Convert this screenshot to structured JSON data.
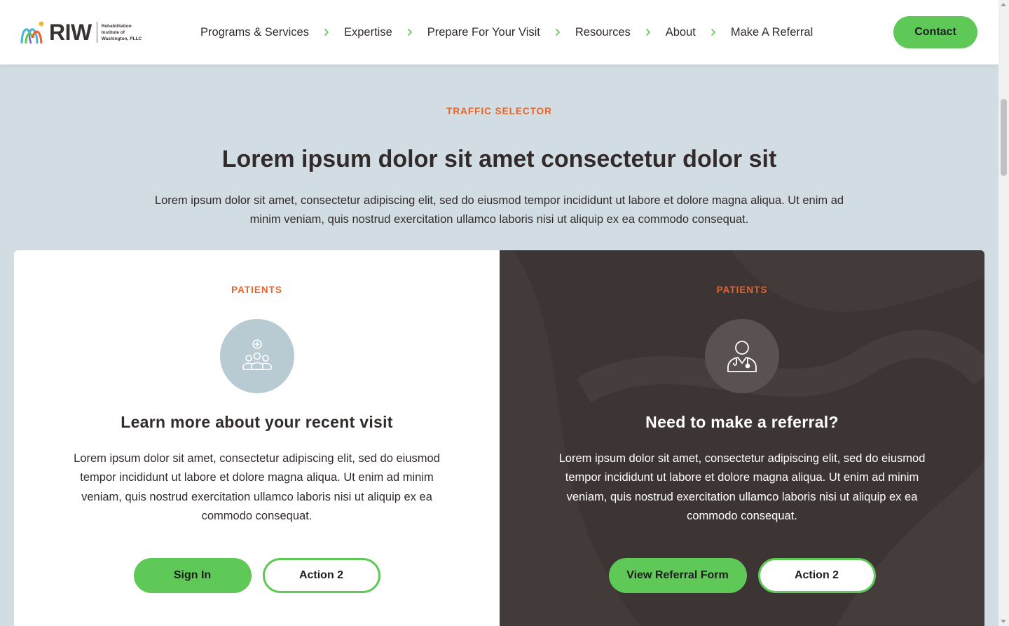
{
  "header": {
    "logo": {
      "wordmark": "RIW",
      "subtitle_lines": [
        "Rehabilitation",
        "Institute of",
        "Washington, PLLC"
      ]
    },
    "nav": [
      {
        "label": "Programs & Services"
      },
      {
        "label": "Expertise"
      },
      {
        "label": "Prepare For Your Visit"
      },
      {
        "label": "Resources"
      },
      {
        "label": "About"
      },
      {
        "label": "Make A Referral"
      }
    ],
    "contact_label": "Contact"
  },
  "intro": {
    "eyebrow": "TRAFFIC SELECTOR",
    "title": "Lorem ipsum dolor sit amet consectetur dolor sit",
    "text": "Lorem ipsum dolor sit amet, consectetur adipiscing elit, sed do eiusmod tempor incididunt ut labore et dolore magna aliqua. Ut enim ad minim veniam, quis nostrud exercitation ullamco laboris nisi ut aliquip ex ea commodo consequat."
  },
  "cards": [
    {
      "eyebrow": "PATIENTS",
      "icon": "patients-group-icon",
      "title": "Learn more about your recent visit",
      "text": "Lorem ipsum dolor sit amet, consectetur adipiscing elit, sed do eiusmod tempor incididunt ut labore et dolore magna aliqua. Ut enim ad minim veniam, quis nostrud exercitation ullamco laboris nisi ut aliquip ex ea commodo consequat.",
      "primary_button": "Sign In",
      "secondary_button": "Action 2"
    },
    {
      "eyebrow": "PATIENTS",
      "icon": "doctor-icon",
      "title": "Need to make a referral?",
      "text": "Lorem ipsum dolor sit amet, consectetur adipiscing elit, sed do eiusmod tempor incididunt ut labore et dolore magna aliqua. Ut enim ad minim veniam, quis nostrud exercitation ullamco laboris nisi ut aliquip ex ea commodo consequat.",
      "primary_button": "View Referral Form",
      "secondary_button": "Action 2"
    }
  ],
  "colors": {
    "accent_green": "#5fc958",
    "eyebrow_orange": "#e8632b",
    "page_background": "#d1dde2",
    "dark_card": "#3d3534",
    "text_dark": "#332b2b"
  }
}
